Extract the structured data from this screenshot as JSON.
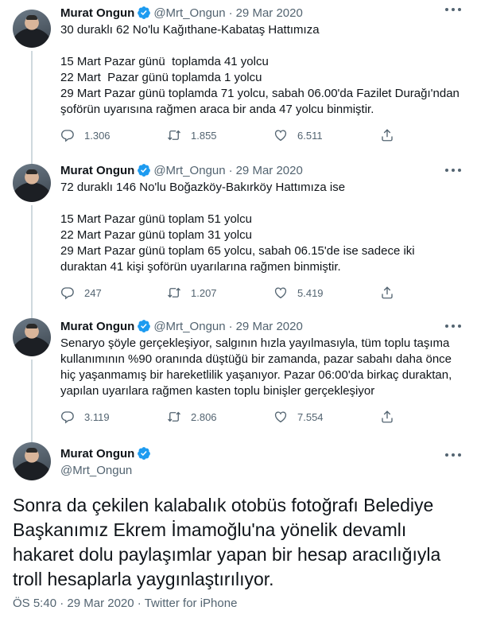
{
  "author": {
    "name": "Murat Ongun",
    "handle": "@Mrt_Ongun"
  },
  "tweets": [
    {
      "date": "29 Mar 2020",
      "text": "30 duraklı 62 No'lu Kağıthane-Kabataş Hattımıza\n\n15 Mart Pazar günü  toplamda 41 yolcu\n22 Mart  Pazar günü toplamda 1 yolcu\n29 Mart Pazar günü toplamda 71 yolcu, sabah 06.00'da Fazilet Durağı'ndan\nşoförün uyarısına rağmen araca bir anda 47 yolcu binmiştir.",
      "replies": "1.306",
      "retweets": "1.855",
      "likes": "6.511"
    },
    {
      "date": "29 Mar 2020",
      "text": "72 duraklı 146 No'lu Boğazköy-Bakırköy Hattımıza ise\n\n15 Mart Pazar günü toplam 51 yolcu\n22 Mart Pazar günü toplam 31 yolcu\n29 Mart Pazar günü toplam 65 yolcu, sabah 06.15'de ise sadece iki\nduraktan 41 kişi şoförün uyarılarına rağmen binmiştir.",
      "replies": "247",
      "retweets": "1.207",
      "likes": "5.419"
    },
    {
      "date": "29 Mar 2020",
      "text": "Senaryo şöyle gerçekleşiyor, salgının hızla yayılmasıyla, tüm toplu taşıma\nkullanımının %90 oranında düştüğü bir zamanda, pazar sabahı daha önce\nhiç yaşanmamış bir hareketlilik yaşanıyor. Pazar 06:00'da birkaç duraktan,\nyapılan uyarılara rağmen kasten toplu binişler gerçekleşiyor",
      "replies": "3.119",
      "retweets": "2.806",
      "likes": "7.554"
    }
  ],
  "main_tweet": {
    "text": "Sonra da çekilen kalabalık otobüs fotoğrafı Belediye Başkanımız Ekrem İmamoğlu'na yönelik devamlı hakaret dolu paylaşımlar yapan bir hesap aracılığıyla troll hesaplarla yaygınlaştırılıyor.",
    "time": "ÖS 5:40",
    "date": "29 Mar 2020",
    "source": "Twitter for iPhone",
    "separator": "·"
  },
  "colors": {
    "verified": "#1d9bf0",
    "secondary_text": "#536471",
    "thread_line": "#cfd9de"
  },
  "icons": [
    "verified-badge-icon",
    "more-icon",
    "reply-icon",
    "retweet-icon",
    "like-icon",
    "share-icon"
  ]
}
